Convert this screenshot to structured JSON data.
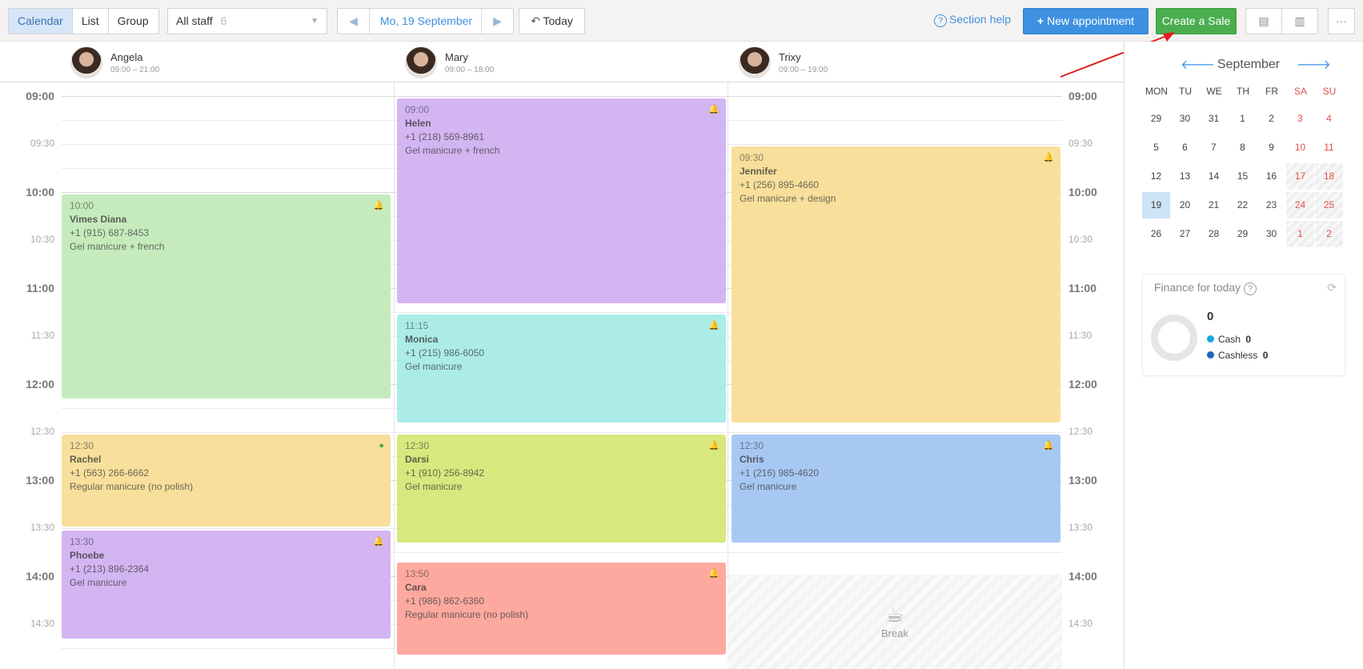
{
  "toolbar": {
    "view_tabs": [
      "Calendar",
      "List",
      "Group"
    ],
    "staff_select": {
      "label": "All staff",
      "count": "6"
    },
    "date": "Mo, 19 September",
    "today_label": "Today",
    "section_help": "Section help",
    "new_appointment": "New appointment",
    "create_sale": "Create a Sale",
    "more": "···"
  },
  "staff": [
    {
      "name": "Angela",
      "hours": "09:00 – 21:00"
    },
    {
      "name": "Mary",
      "hours": "09:00 – 18:00"
    },
    {
      "name": "Trixy",
      "hours": "09:00 – 19:00"
    }
  ],
  "time_labels": [
    "09:00",
    "09:30",
    "10:00",
    "10:30",
    "11:00",
    "11:30",
    "12:00",
    "12:30",
    "13:00",
    "13:30",
    "14:00",
    "14:30"
  ],
  "appointments": [
    {
      "col": 0,
      "time": "10:00",
      "client": "Vimes Diana",
      "phone": "+1 (915) 687-8453",
      "service": "Gel manicure + french",
      "color": "#c5ebbd",
      "icon": "bell-icon"
    },
    {
      "col": 0,
      "time": "12:30",
      "client": "Rachel",
      "phone": "+1 (563) 266-6662",
      "service": "Regular manicure (no polish)",
      "color": "#f8df9c",
      "icon": "user-check-icon"
    },
    {
      "col": 0,
      "time": "13:30",
      "client": "Phoebe",
      "phone": "+1 (213) 896-2364",
      "service": "Gel manicure",
      "color": "#d3b5f2",
      "icon": "bell-icon"
    },
    {
      "col": 1,
      "time": "09:00",
      "client": "Helen",
      "phone": "+1 (218) 569-8961",
      "service": "Gel manicure + french",
      "color": "#d3b5f2",
      "icon": "bell-icon"
    },
    {
      "col": 1,
      "time": "11:15",
      "client": "Monica",
      "phone": "+1 (215) 986-6050",
      "service": "Gel manicure",
      "color": "#abece7",
      "icon": "bell-icon"
    },
    {
      "col": 1,
      "time": "12:30",
      "client": "Darsi",
      "phone": "+1 (910) 256-8942",
      "service": "Gel manicure",
      "color": "#d8e87e",
      "icon": "bell-icon"
    },
    {
      "col": 1,
      "time": "13:50",
      "client": "Cara",
      "phone": "+1 (986) 862-6360",
      "service": "Regular manicure (no polish)",
      "color": "#fea99f",
      "icon": "bell-icon"
    },
    {
      "col": 2,
      "time": "09:30",
      "client": "Jennifer",
      "phone": "+1 (256) 895-4660",
      "service": "Gel manicure + design",
      "color": "#f8df9c",
      "icon": "bell-icon"
    },
    {
      "col": 2,
      "time": "12:30",
      "client": "Chris",
      "phone": "+1 (216) 985-4620",
      "service": "Gel manicure",
      "color": "#a8c8f4",
      "icon": "bell-icon"
    }
  ],
  "break_label": "Break",
  "mini_calendar": {
    "month": "September",
    "dow": [
      "MON",
      "TU",
      "WE",
      "TH",
      "FR",
      "SA",
      "SU"
    ],
    "weeks": [
      [
        "29",
        "30",
        "31",
        "1",
        "2",
        "3",
        "4"
      ],
      [
        "5",
        "6",
        "7",
        "8",
        "9",
        "10",
        "11"
      ],
      [
        "12",
        "13",
        "14",
        "15",
        "16",
        "17",
        "18"
      ],
      [
        "19",
        "20",
        "21",
        "22",
        "23",
        "24",
        "25"
      ],
      [
        "26",
        "27",
        "28",
        "29",
        "30",
        "1",
        "2"
      ]
    ],
    "today": "19"
  },
  "finance": {
    "title": "Finance for today",
    "total": "0",
    "cash_label": "Cash",
    "cash_value": "0",
    "cashless_label": "Cashless",
    "cashless_value": "0",
    "cash_color": "#1aa7e0",
    "cashless_color": "#1769b8"
  }
}
